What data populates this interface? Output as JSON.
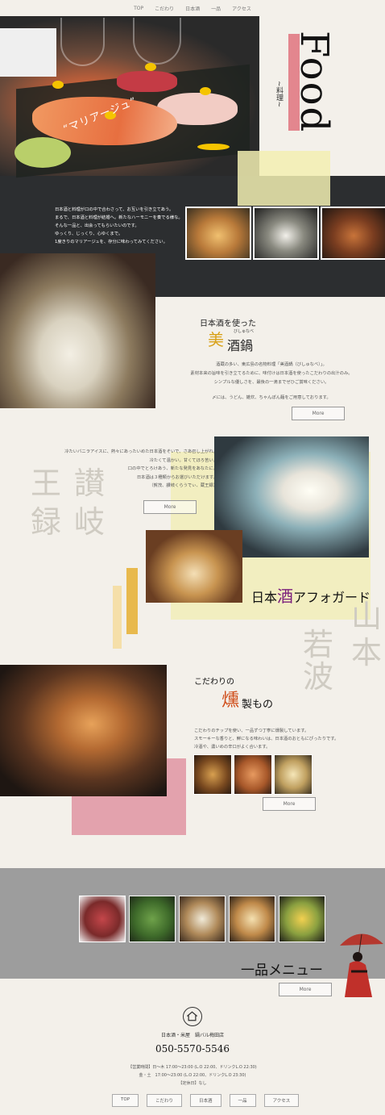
{
  "nav": [
    "TOP",
    "こだわり",
    "日本酒",
    "一品",
    "アクセス"
  ],
  "hero": {
    "title": "Food",
    "subtitle": "~料理~",
    "mariage": "“マリアージュ”",
    "text": [
      "日本酒と料理が口の中で合わさって、お互いを引き立てあう。",
      "まるで、日本酒と料理が結婚へ。新たなハーモニーを奏でる様な。",
      "そんな一品と、出会ってもらいたいのです。",
      "ゆっくり、じっくり、心ゆくまで。",
      "1度きりのマリアージュを、存分に味わってみてください。"
    ]
  },
  "nabe": {
    "title_small": "日本酒を使った",
    "title_big": "美",
    "title_rest": "酒鍋",
    "ruby": "びしゅなべ",
    "text": [
      "酒蔵の多い、東広島の名物料理「美酒鍋（びしゅなべ）」。",
      "素材本来の旨味を引き立てるために、味付けは日本酒を使ったこだわりの出汁のみ。",
      "シンプルな優しさを、最後の一滴までぜひご賞味ください。",
      "",
      "〆には、うどん、雑炊、ちゃんぽん麺をご用意しております。"
    ],
    "more": "More"
  },
  "affogato": {
    "text": [
      "冷たいバニラアイスに、熱々にあったいめた日本酒をそいで、さあ召し上がれ。",
      "冷たくて温かい。甘くてほろ苦い。",
      "口の中でとろけあう、新たな発見をあなたに。",
      "日本酒は３種類からお選びいただけます。",
      "（賀茂、讃岐くらうでぃ、蔵王録）"
    ],
    "more": "More",
    "title_a": "日本",
    "title_hl": "酒",
    "title_b": "アフォガード",
    "bg_kanji": [
      "王",
      "讃",
      "録",
      "岐",
      "山",
      "本",
      "若",
      "波"
    ]
  },
  "smoked": {
    "title1": "こだわりの",
    "title_big": "燻",
    "title2": "製もの",
    "text": [
      "こだわりのチップを使い、一品ずつ丁寧に燻製しています。",
      "スモーキーな香りと、鮮になる味わいは、日本酒のおともにぴったりです。",
      "冷酒や、濃いめの辛口がよく合います。"
    ],
    "more": "More"
  },
  "ippin": {
    "title": "一品メニュー",
    "more": "More"
  },
  "footer": {
    "shop": "日本酒・米屋　鍋バル梅田店",
    "phone": "050-5570-5546",
    "hours1": "【営業時間】日～木 17:00～23:00 (L.O 22:00、ドリンクL.O 22:30)",
    "hours2": "金・土　17:00～23:00 (L.O 22:00、ドリンクL.O 23:30)",
    "holiday": "【定休日】なし",
    "nav": [
      "TOP",
      "こだわり",
      "日本酒",
      "一品",
      "アクセス"
    ]
  }
}
